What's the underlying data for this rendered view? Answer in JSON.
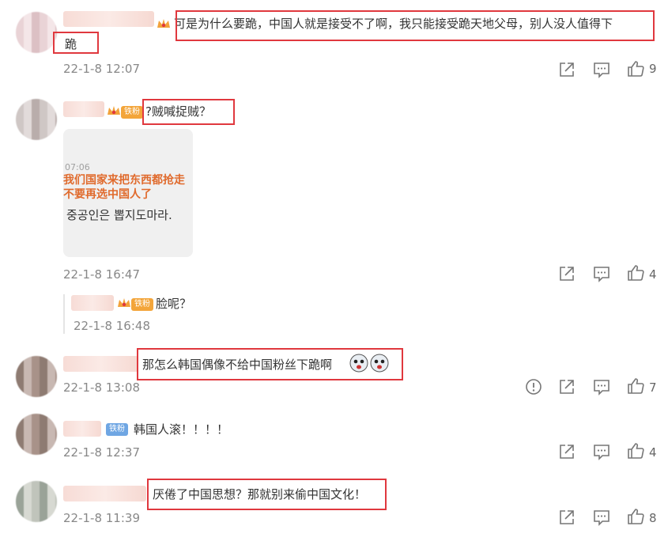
{
  "comments": [
    {
      "text": "可是为什么要跪，中国人就是接受不了啊，我只能接受跪天地父母，别人没人值得下",
      "text2": "跪",
      "time": "22-1-8 12:07",
      "likes": "9"
    },
    {
      "text": "?贼喊捉贼？",
      "time": "22-1-8 16:47",
      "likes": "4",
      "badge": "铁粉",
      "image": {
        "time_label": "07:06",
        "line1": "我们国家来把东西都抢走",
        "line2": "不要再选中国人了",
        "line3": "중공인은 뽑지도마라."
      }
    },
    {
      "text": "脸呢？",
      "time": "22-1-8 16:48",
      "badge": "铁粉"
    },
    {
      "text": "那怎么韩国偶像不给中国粉丝下跪啊",
      "time": "22-1-8 13:08",
      "likes": "7"
    },
    {
      "text": "韩国人滚！！！！",
      "time": "22-1-8 12:37",
      "likes": "4",
      "badge": "铁粉"
    },
    {
      "text": "厌倦了中国思想？那就别来偷中国文化！",
      "time": "22-1-8 11:39",
      "likes": "8"
    }
  ],
  "icons": {
    "share": "share-icon",
    "comment": "comment-icon",
    "like": "thumbs-up-icon",
    "report": "report-icon"
  },
  "colors": {
    "highlight": "#e0383e",
    "badge": "#6fa6e3"
  }
}
